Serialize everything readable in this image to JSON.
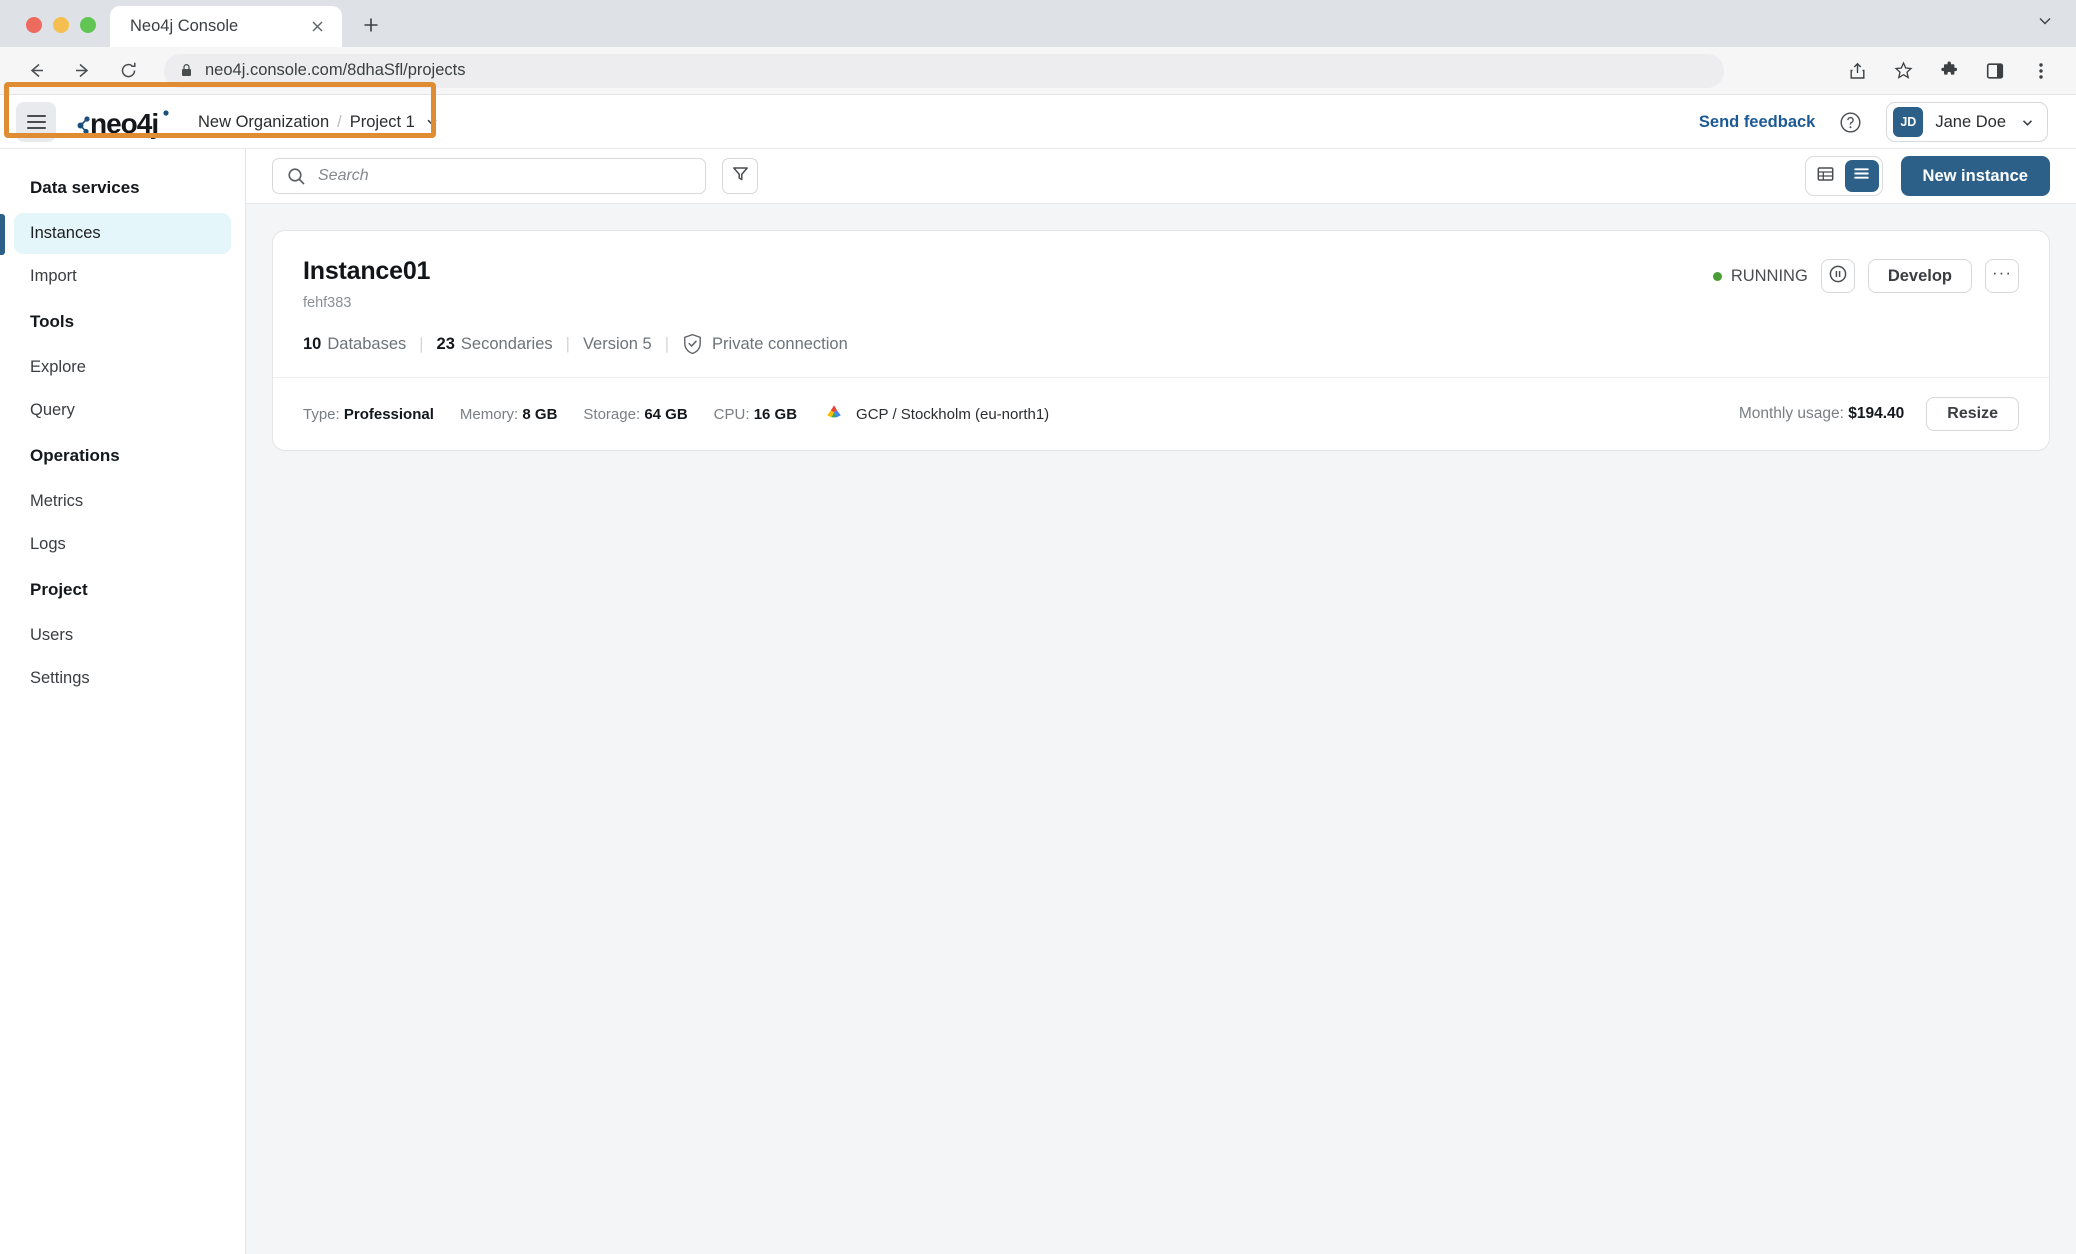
{
  "browser": {
    "tab_title": "Neo4j Console",
    "url": "neo4j.console.com/8dhaSfl/projects",
    "close_label": "×",
    "new_tab_label": "+"
  },
  "header": {
    "logo_text": "neo4j",
    "breadcrumb": {
      "organization": "New Organization",
      "separator": "/",
      "project": "Project 1"
    },
    "send_feedback": "Send feedback",
    "user": {
      "initials": "JD",
      "name": "Jane Doe"
    }
  },
  "sidebar": {
    "groups": [
      {
        "title": "Data services",
        "items": [
          {
            "label": "Instances",
            "active": true
          },
          {
            "label": "Import",
            "active": false
          }
        ]
      },
      {
        "title": "Tools",
        "items": [
          {
            "label": "Explore",
            "active": false
          },
          {
            "label": "Query",
            "active": false
          }
        ]
      },
      {
        "title": "Operations",
        "items": [
          {
            "label": "Metrics",
            "active": false
          },
          {
            "label": "Logs",
            "active": false
          }
        ]
      },
      {
        "title": "Project",
        "items": [
          {
            "label": "Users",
            "active": false
          },
          {
            "label": "Settings",
            "active": false
          }
        ]
      }
    ]
  },
  "toolbar": {
    "search_placeholder": "Search",
    "search_value": "",
    "view_grid_label": "table-view",
    "view_list_label": "list-view",
    "new_instance_label": "New instance"
  },
  "instance": {
    "name": "Instance01",
    "id": "fehf383",
    "meta": {
      "databases_count": "10",
      "databases_label": "Databases",
      "secondaries_count": "23",
      "secondaries_label": "Secondaries",
      "version": "Version 5",
      "connection": "Private connection"
    },
    "status": "RUNNING",
    "develop_label": "Develop",
    "more_label": "···",
    "specs": {
      "type_label": "Type:",
      "type_value": "Professional",
      "memory_label": "Memory:",
      "memory_value": "8 GB",
      "storage_label": "Storage:",
      "storage_value": "64 GB",
      "cpu_label": "CPU:",
      "cpu_value": "16 GB",
      "cloud_region": "GCP / Stockholm (eu-north1)"
    },
    "monthly_usage_label": "Monthly usage:",
    "monthly_usage_value": "$194.40",
    "resize_label": "Resize"
  },
  "colors": {
    "brand_blue": "#2d6089",
    "link_blue": "#1d5a94",
    "annotation_orange": "#e08c33",
    "status_green": "#4a9d34",
    "active_nav_bg": "#e5f6fa"
  }
}
